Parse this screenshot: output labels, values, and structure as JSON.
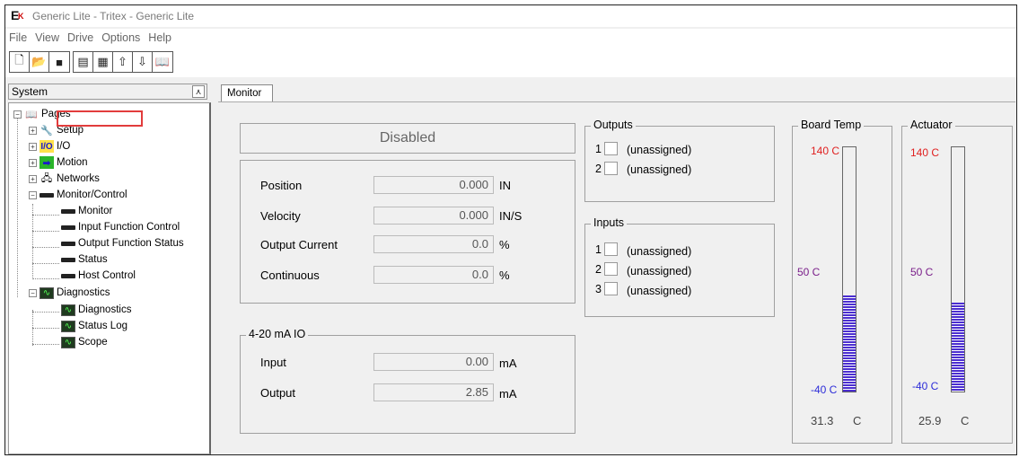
{
  "window": {
    "title": "Generic Lite - Tritex - Generic Lite"
  },
  "menu": [
    "File",
    "View",
    "Drive",
    "Options",
    "Help"
  ],
  "toolbar_icons": [
    "new-file-icon",
    "open-folder-icon",
    "save-icon",
    "network-icon",
    "multi-drive-icon",
    "upload-icon",
    "download-icon",
    "manual-icon"
  ],
  "sidebar": {
    "header": "System",
    "tree": {
      "pages": "Pages",
      "setup": "Setup",
      "io": "I/O",
      "motion": "Motion",
      "networks": "Networks",
      "monitor_control": "Monitor/Control",
      "monitor": "Monitor",
      "input_function_control": "Input Function Control",
      "output_function_status": "Output Function Status",
      "status": "Status",
      "host_control": "Host Control",
      "diagnostics_group": "Diagnostics",
      "diagnostics": "Diagnostics",
      "status_log": "Status Log",
      "scope": "Scope"
    },
    "io_icon_text": "I/O"
  },
  "tab": {
    "label": "Monitor"
  },
  "drive_status": "Disabled",
  "readings": {
    "position": {
      "label": "Position",
      "value": "0.000",
      "unit": "IN"
    },
    "velocity": {
      "label": "Velocity",
      "value": "0.000",
      "unit": "IN/S"
    },
    "output_current": {
      "label": "Output Current",
      "value": "0.0",
      "unit": "%"
    },
    "continuous": {
      "label": "Continuous",
      "value": "0.0",
      "unit": "%"
    }
  },
  "analog_io": {
    "title": "4-20 mA IO",
    "input": {
      "label": "Input",
      "value": "0.00",
      "unit": "mA"
    },
    "output": {
      "label": "Output",
      "value": "2.85",
      "unit": "mA"
    }
  },
  "outputs": {
    "title": "Outputs",
    "items": [
      {
        "num": "1",
        "label": "(unassigned)"
      },
      {
        "num": "2",
        "label": "(unassigned)"
      }
    ]
  },
  "inputs": {
    "title": "Inputs",
    "items": [
      {
        "num": "1",
        "label": "(unassigned)"
      },
      {
        "num": "2",
        "label": "(unassigned)"
      },
      {
        "num": "3",
        "label": "(unassigned)"
      }
    ]
  },
  "board_temp": {
    "title": "Board Temp",
    "max_label": "140 C",
    "mid_label": "50 C",
    "min_label": "-40 C",
    "reading": "31.3",
    "unit": "C",
    "fill_fraction": 0.395
  },
  "actuator": {
    "title": "Actuator",
    "max_label": "140 C",
    "mid_label": "50 C",
    "min_label": "-40 C",
    "reading": "25.9",
    "unit": "C",
    "fill_fraction": 0.365
  },
  "colors": {
    "max": "#e02020",
    "mid": "#7a1f8a",
    "min": "#2c2cd8",
    "gauge": "#4b2ed0",
    "highlight": "#e23c3c"
  }
}
